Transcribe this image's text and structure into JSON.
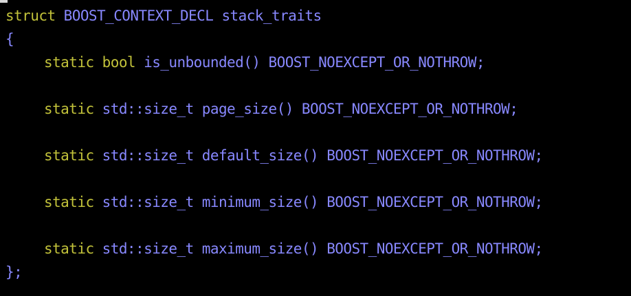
{
  "code": {
    "line1": {
      "keyword": "struct",
      "macro": "BOOST_CONTEXT_DECL",
      "name": "stack_traits"
    },
    "line2": {
      "brace": "{"
    },
    "line3": {
      "static": "static",
      "type": "bool",
      "func": "is_unbounded()",
      "macro": "BOOST_NOEXCEPT_OR_NOTHROW;"
    },
    "line5": {
      "static": "static",
      "type": "std::size_t",
      "func": "page_size()",
      "macro": "BOOST_NOEXCEPT_OR_NOTHROW;"
    },
    "line7": {
      "static": "static",
      "type": "std::size_t",
      "func": "default_size()",
      "macro": "BOOST_NOEXCEPT_OR_NOTHROW;"
    },
    "line9": {
      "static": "static",
      "type": "std::size_t",
      "func": "minimum_size()",
      "macro": "BOOST_NOEXCEPT_OR_NOTHROW;"
    },
    "line11": {
      "static": "static",
      "type": "std::size_t",
      "func": "maximum_size()",
      "macro": "BOOST_NOEXCEPT_OR_NOTHROW;"
    },
    "line12": {
      "close": "};"
    }
  },
  "colors": {
    "background": "#000000",
    "keyword": "#c2c23a",
    "identifier": "#8888ff",
    "cursor": "#d8d8d8"
  }
}
